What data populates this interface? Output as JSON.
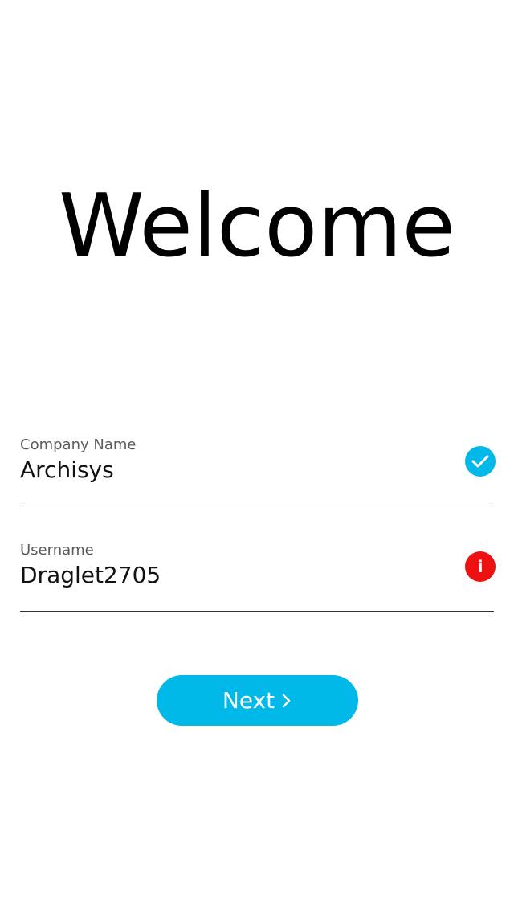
{
  "title": "Welcome",
  "form": {
    "company": {
      "label": "Company Name",
      "value": "Archisys",
      "status": "valid",
      "status_icon": "check-icon",
      "status_color": "#00b9e8"
    },
    "username": {
      "label": "Username",
      "value": "Draglet2705",
      "status": "error",
      "status_icon": "info-icon",
      "status_glyph": "i",
      "status_color": "#ee1111"
    }
  },
  "next_button": {
    "label": "Next",
    "icon": "chevron-right-icon",
    "color": "#00b9e8"
  }
}
